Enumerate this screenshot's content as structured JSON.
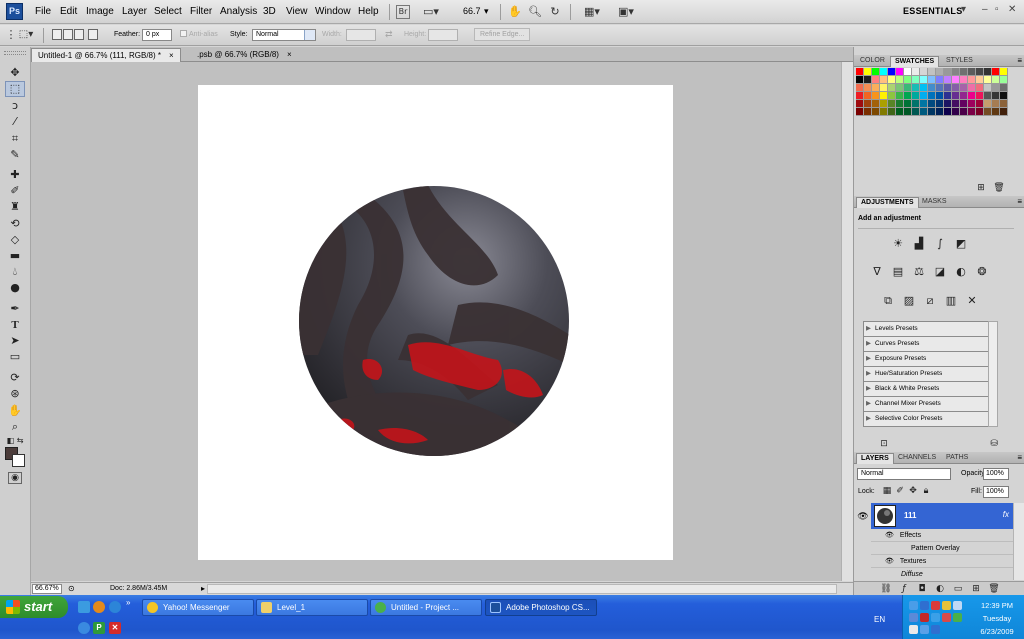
{
  "app": {
    "logo": "Ps",
    "workspace": "ESSENTIALS",
    "zoom": "66.7"
  },
  "menu": [
    "File",
    "Edit",
    "Image",
    "Layer",
    "Select",
    "Filter",
    "Analysis",
    "3D",
    "View",
    "Window",
    "Help"
  ],
  "options": {
    "feather_label": "Feather:",
    "feather_value": "0 px",
    "antialias_label": "Anti-alias",
    "style_label": "Style:",
    "style_value": "Normal",
    "width_label": "Width:",
    "height_label": "Height:",
    "refine_edge": "Refine Edge..."
  },
  "documents": [
    {
      "title": "Untitled-1 @ 66.7% (111, RGB/8) *",
      "close": "×"
    },
    {
      "title": ".psb @ 66.7% (RGB/8)",
      "close": "×"
    }
  ],
  "status": {
    "zoom": "66.67%",
    "doc": "Doc: 2.86M/3.45M"
  },
  "swatches_panel": {
    "tabs": [
      "COLOR",
      "SWATCHES",
      "STYLES"
    ],
    "active": "SWATCHES"
  },
  "adjustments_panel": {
    "tabs": [
      "ADJUSTMENTS",
      "MASKS"
    ],
    "title": "Add an adjustment",
    "presets": [
      "Levels Presets",
      "Curves Presets",
      "Exposure Presets",
      "Hue/Saturation Presets",
      "Black & White Presets",
      "Channel Mixer Presets",
      "Selective Color Presets"
    ]
  },
  "layers_panel": {
    "tabs": [
      "LAYERS",
      "CHANNELS",
      "PATHS"
    ],
    "blend_mode": "Normal",
    "opacity_label": "Opacity:",
    "opacity_value": "100%",
    "lock_label": "Lock:",
    "fill_label": "Fill:",
    "fill_value": "100%",
    "layer_name": "111",
    "fx": "fx",
    "effects_label": "Effects",
    "pattern_overlay": "Pattern Overlay",
    "textures_label": "Textures",
    "diffuse_label": "Diffuse"
  },
  "taskbar": {
    "start": "start",
    "tasks": [
      "Yahoo! Messenger",
      "Level_1",
      "Untitled    - Project ...",
      "Adobe Photoshop CS..."
    ],
    "lang": "EN",
    "time": "12:39 PM",
    "day": "Tuesday",
    "date": "6/23/2009"
  },
  "colors": {
    "foreground": "#4b3c3a",
    "background": "#ffffff",
    "selection": "#3465d3",
    "taskbar": "#245edb"
  }
}
